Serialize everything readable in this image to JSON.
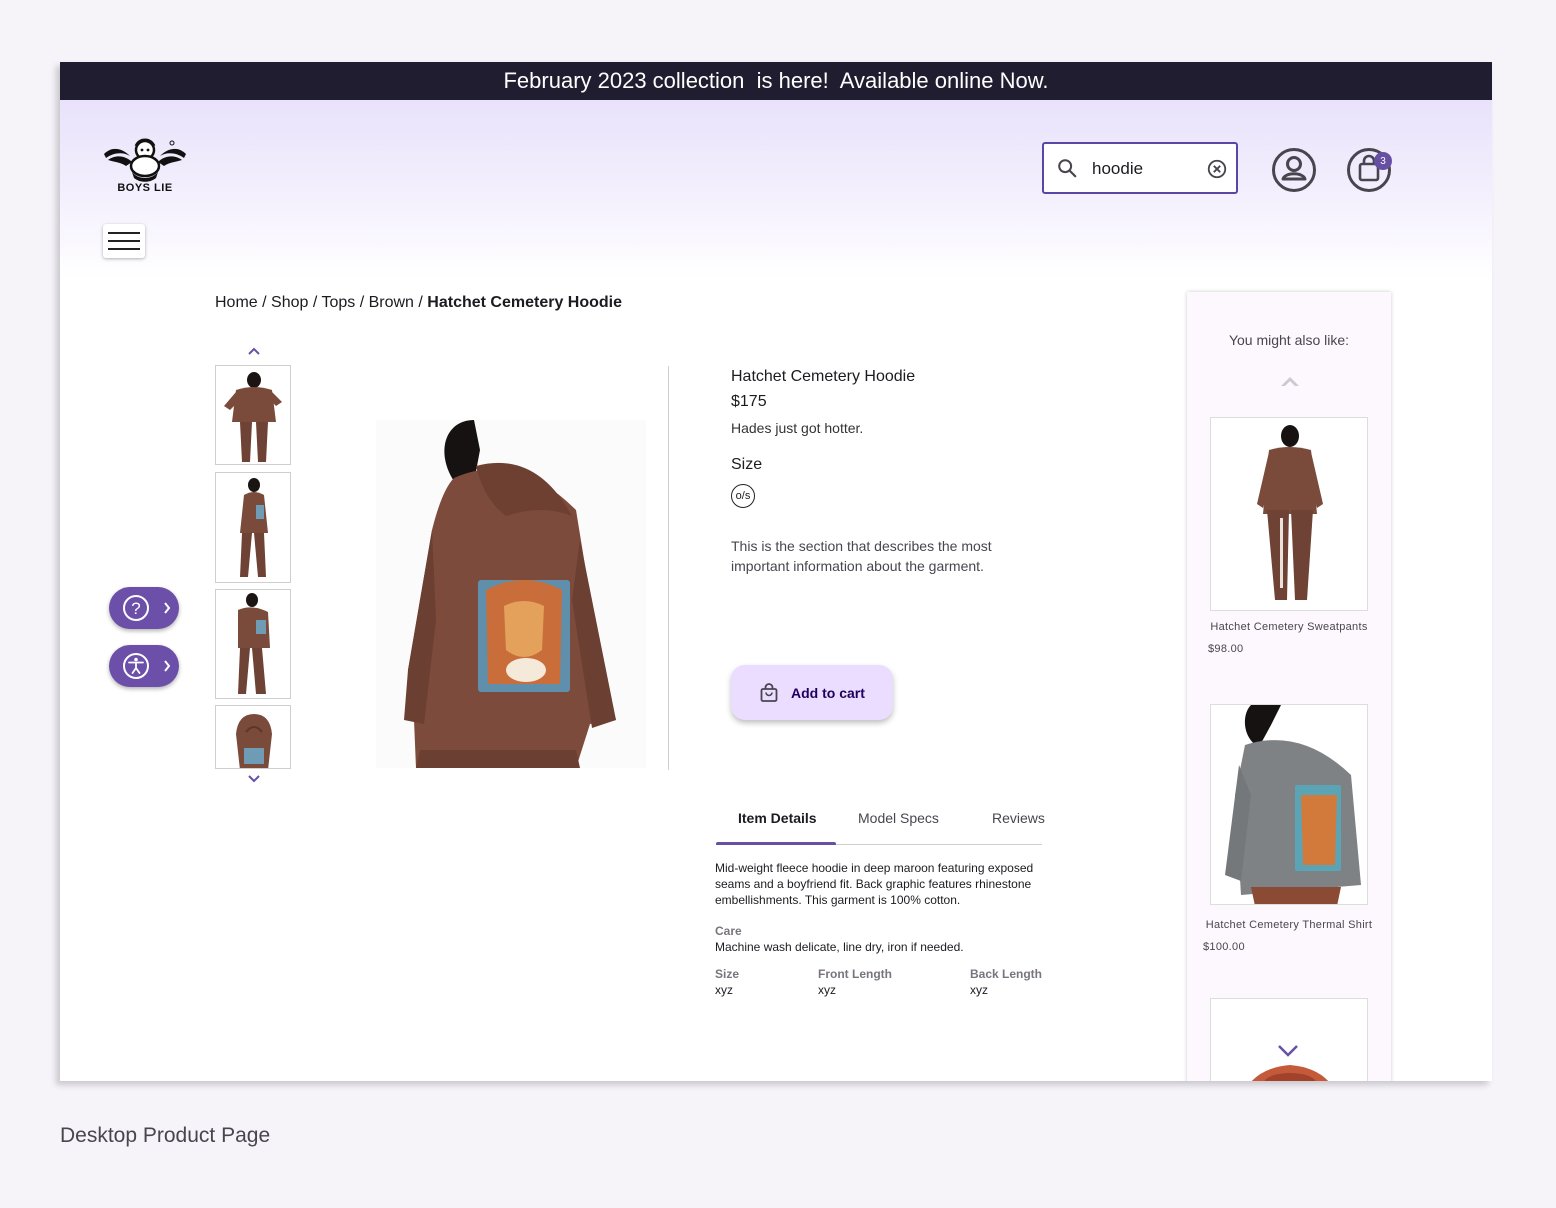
{
  "announcement": "February 2023 collection  is here!  Available online Now.",
  "brand": {
    "logo_text": "BOYS LIE"
  },
  "search": {
    "value": "hoodie",
    "placeholder": ""
  },
  "cart": {
    "count": "3"
  },
  "breadcrumb": {
    "items": [
      "Home",
      "Shop",
      "Tops",
      "Brown"
    ],
    "separator": " / ",
    "current": "Hatchet Cemetery Hoodie"
  },
  "product": {
    "title": "Hatchet Cemetery Hoodie",
    "price": "$175",
    "tagline": "Hades just got hotter.",
    "size_label": "Size",
    "size_option": "o/s",
    "description": "This is the section that describes the most important information about the garment.",
    "add_to_cart": "Add to cart",
    "color_hex": "#7a4a3a"
  },
  "tabs": [
    "Item Details",
    "Model Specs",
    "Reviews"
  ],
  "item_details": {
    "text": "Mid-weight fleece hoodie in deep maroon featuring exposed seams and a boyfriend fit. Back graphic features rhinestone embellishments. This garment is 100% cotton.",
    "care_label": "Care",
    "care_text": "Machine wash delicate, line dry, iron if needed.",
    "specs": [
      {
        "label": "Size",
        "value": "xyz"
      },
      {
        "label": "Front Length",
        "value": "xyz"
      },
      {
        "label": "Back Length",
        "value": "xyz"
      }
    ]
  },
  "recommendations": {
    "title": "You might also like:",
    "items": [
      {
        "name": "Hatchet Cemetery Sweatpants",
        "price": "$98.00"
      },
      {
        "name": "Hatchet Cemetery Thermal Shirt",
        "price": "$100.00"
      }
    ]
  },
  "colors": {
    "accent": "#6750a4",
    "banner": "#1f1d2f",
    "fab": "#6b4fa9",
    "cart_button": "#eaddff"
  },
  "caption": "Desktop Product Page"
}
